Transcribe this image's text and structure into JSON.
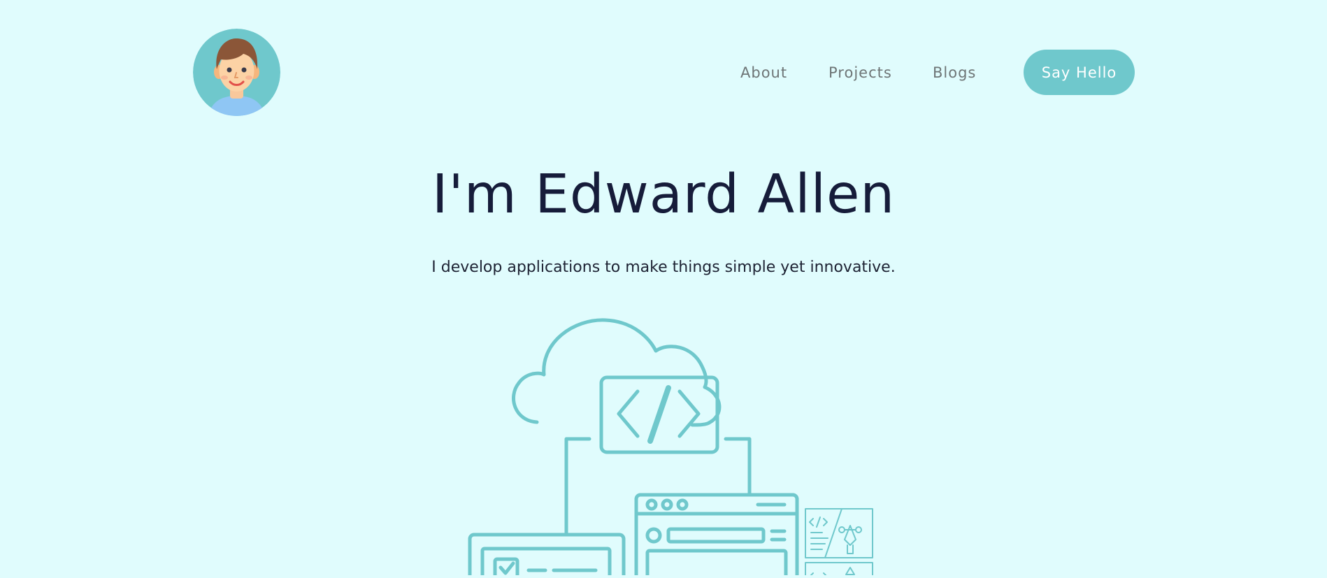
{
  "header": {
    "avatar_alt": "Edward Allen avatar",
    "nav": {
      "about": "About",
      "projects": "Projects",
      "blogs": "Blogs"
    },
    "cta_label": "Say Hello"
  },
  "hero": {
    "title": "I'm Edward Allen",
    "subtitle": "I develop applications to make things simple yet innovative."
  },
  "illustration": {
    "icon": "cloud-code-devices-illustration"
  },
  "colors": {
    "background": "#e0fcfd",
    "accent": "#6fc8cc",
    "heading": "#161c3a",
    "nav_text": "#6e7576"
  }
}
